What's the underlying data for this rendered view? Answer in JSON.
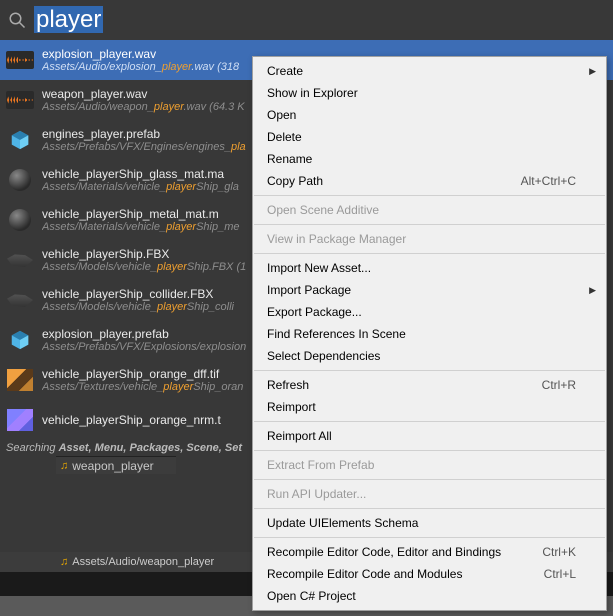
{
  "search": {
    "query": "player"
  },
  "results": [
    {
      "kind": "wave",
      "title": "explosion_player.wav",
      "path_pre": "Assets/Audio/explosion_",
      "path_hl": "player",
      "path_post": ".wav (318",
      "selected": true
    },
    {
      "kind": "wave",
      "title": "weapon_player.wav",
      "path_pre": "Assets/Audio/weapon_",
      "path_hl": "player",
      "path_post": ".wav (64.3 K"
    },
    {
      "kind": "cube",
      "title": "engines_player.prefab",
      "path_pre": "Assets/Prefabs/VFX/Engines/engines_",
      "path_hl": "pla",
      "path_post": ""
    },
    {
      "kind": "sphere",
      "title": "vehicle_playerShip_glass_mat.ma",
      "path_pre": "Assets/Materials/vehicle_",
      "path_hl": "player",
      "path_post": "Ship_gla"
    },
    {
      "kind": "sphere",
      "title": "vehicle_playerShip_metal_mat.m",
      "path_pre": "Assets/Materials/vehicle_",
      "path_hl": "player",
      "path_post": "Ship_me"
    },
    {
      "kind": "mesh",
      "title": "vehicle_playerShip.FBX",
      "path_pre": "Assets/Models/vehicle_",
      "path_hl": "player",
      "path_post": "Ship.FBX (1"
    },
    {
      "kind": "mesh",
      "title": "vehicle_playerShip_collider.FBX",
      "path_pre": "Assets/Models/vehicle_",
      "path_hl": "player",
      "path_post": "Ship_colli"
    },
    {
      "kind": "cube",
      "title": "explosion_player.prefab",
      "path_pre": "Assets/Prefabs/VFX/Explosions/explosion",
      "path_hl": "",
      "path_post": ""
    },
    {
      "kind": "tex",
      "title": "vehicle_playerShip_orange_dff.tif",
      "path_pre": "Assets/Textures/vehicle_",
      "path_hl": "player",
      "path_post": "Ship_oran"
    },
    {
      "kind": "nrm",
      "title": "vehicle_playerShip_orange_nrm.t",
      "path_pre": "",
      "path_hl": "",
      "path_post": ""
    }
  ],
  "searching": {
    "prefix": "Searching ",
    "scopes": "Asset, Menu, Packages, Scene, Set"
  },
  "tab": {
    "label": "weapon_player"
  },
  "bottom": {
    "path": "Assets/Audio/weapon_player"
  },
  "menu": [
    {
      "label": "Create",
      "submenu": true
    },
    {
      "label": "Show in Explorer"
    },
    {
      "label": "Open"
    },
    {
      "label": "Delete"
    },
    {
      "label": "Rename"
    },
    {
      "label": "Copy Path",
      "shortcut": "Alt+Ctrl+C"
    },
    {
      "sep": true
    },
    {
      "label": "Open Scene Additive",
      "disabled": true
    },
    {
      "sep": true
    },
    {
      "label": "View in Package Manager",
      "disabled": true
    },
    {
      "sep": true
    },
    {
      "label": "Import New Asset..."
    },
    {
      "label": "Import Package",
      "submenu": true
    },
    {
      "label": "Export Package..."
    },
    {
      "label": "Find References In Scene"
    },
    {
      "label": "Select Dependencies"
    },
    {
      "sep": true
    },
    {
      "label": "Refresh",
      "shortcut": "Ctrl+R"
    },
    {
      "label": "Reimport"
    },
    {
      "sep": true
    },
    {
      "label": "Reimport All"
    },
    {
      "sep": true
    },
    {
      "label": "Extract From Prefab",
      "disabled": true
    },
    {
      "sep": true
    },
    {
      "label": "Run API Updater...",
      "disabled": true
    },
    {
      "sep": true
    },
    {
      "label": "Update UIElements Schema"
    },
    {
      "sep": true
    },
    {
      "label": "Recompile Editor Code, Editor and Bindings",
      "shortcut": "Ctrl+K"
    },
    {
      "label": "Recompile Editor Code and Modules",
      "shortcut": "Ctrl+L"
    },
    {
      "label": "Open C# Project"
    }
  ]
}
